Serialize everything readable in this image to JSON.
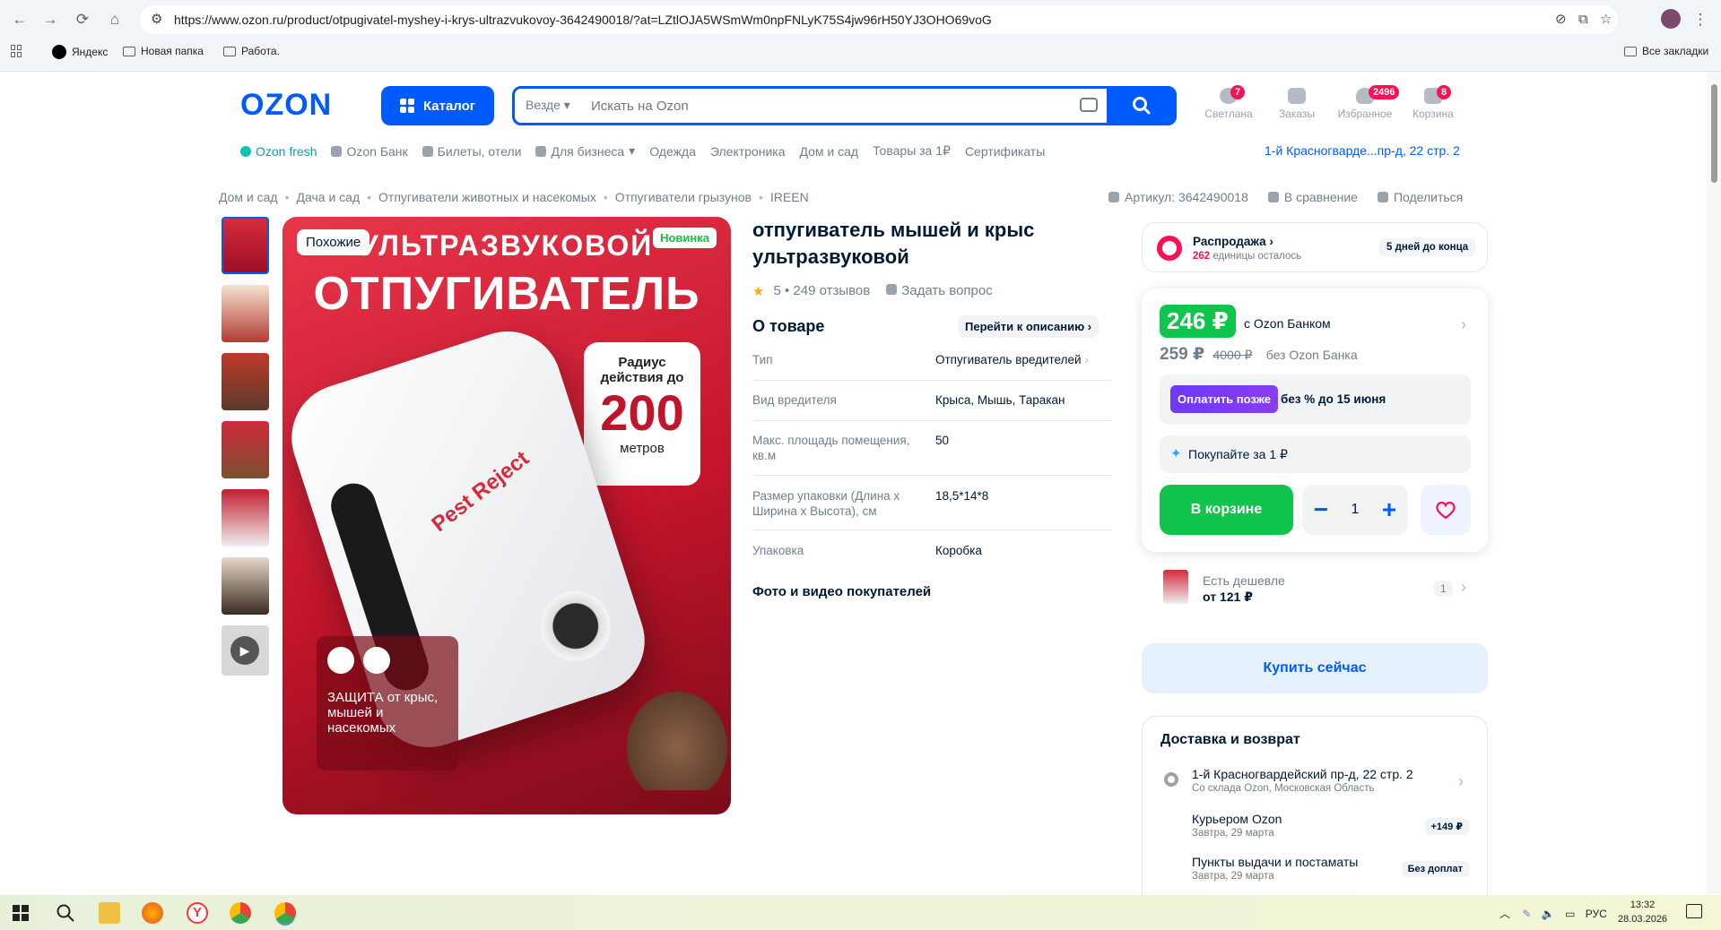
{
  "browser": {
    "url": "https://www.ozon.ru/product/otpugivatel-myshey-i-krys-ultrazvukovoy-3642490018/?at=LZtlOJA5WSmWm0npFNLyK75S4jw96rH50YJ3OHO69voG",
    "bookmarks": [
      "Яндекс",
      "Новая папка",
      "Работа."
    ],
    "all_bookmarks": "Все закладки"
  },
  "header": {
    "logo": "OZON",
    "catalog_label": "Каталог",
    "search_scope": "Везде",
    "search_placeholder": "Искать на Ozon",
    "icons": [
      {
        "label": "Светлана",
        "badge": "7"
      },
      {
        "label": "Заказы",
        "badge": ""
      },
      {
        "label": "Избранное",
        "badge": "2496"
      },
      {
        "label": "Корзина",
        "badge": "8"
      }
    ],
    "subnav": [
      "Ozon fresh",
      "Ozon Банк",
      "Билеты, отели",
      "Для бизнеса",
      "Одежда",
      "Электроника",
      "Дом и сад",
      "Товары за 1₽",
      "Сертификаты"
    ],
    "address": "1-й Красногварде...пр-д, 22 стр. 2"
  },
  "breadcrumbs": [
    "Дом и сад",
    "Дача и сад",
    "Отпугиватели животных и насекомых",
    "Отпугиватели грызунов",
    "IREEN"
  ],
  "top_actions": {
    "article": "Артикул: 3642490018",
    "compare": "В сравнение",
    "share": "Поделиться"
  },
  "gallery": {
    "tag_similar": "Похожие",
    "tag_new": "Новинка",
    "image_text": {
      "headline1": "УЛЬТРАЗВУКОВОЙ",
      "headline2": "ОТПУГИВАТЕЛЬ",
      "radius_label": "Радиус действия до",
      "radius_value": "200",
      "radius_unit": "метров",
      "device_brand": "Pest Reject",
      "protection": "ЗАЩИТА от крыс, мышей и насекомых"
    },
    "thumbnail_count": 7
  },
  "product": {
    "title": "отпугиватель мышей и крыс ультразвуковой",
    "rating": "5",
    "reviews": "249 отзывов",
    "ask": "Задать вопрос",
    "about_title": "О товаре",
    "to_description": "Перейти к описанию",
    "specs": [
      {
        "key": "Тип",
        "value": "Отпугиватель вредителей"
      },
      {
        "key": "Вид вредителя",
        "value": "Крыса, Мышь, Таракан"
      },
      {
        "key": "Макс. площадь помещения, кв.м",
        "value": "50"
      },
      {
        "key": "Размер упаковки (Длина х Ширина х Высота), см",
        "value": "18,5*14*8"
      },
      {
        "key": "Упаковка",
        "value": "Коробка"
      }
    ],
    "photos_title": "Фото и видео покупателей"
  },
  "sale": {
    "title": "Распродажа",
    "remaining_count": "262",
    "remaining_text": "единицы осталось",
    "days_left": "5 дней до конца"
  },
  "pricing": {
    "price_bank": "246 ₽",
    "price_bank_label": "с Ozon Банком",
    "price": "259 ₽",
    "old_price": "4000 ₽",
    "price_label": "без Ozon Банка",
    "pay_later_btn": "Оплатить позже",
    "pay_later_text": "без % до 15 июня",
    "buy_for_1": "Покупайте за 1 ₽",
    "cart_button": "В корзине",
    "quantity": "1",
    "cheaper_title": "Есть дешевле",
    "cheaper_price": "от 121 ₽",
    "cheaper_count": "1",
    "buy_now": "Купить сейчас"
  },
  "delivery": {
    "title": "Доставка и возврат",
    "address": "1-й Красногвардейский пр-д, 22 стр. 2",
    "warehouse": "Со склада Ozon, Московская Область",
    "options": [
      {
        "name": "Курьером Ozon",
        "date": "Завтра, 29 марта",
        "price": "+149 ₽"
      },
      {
        "name": "Пункты выдачи и постаматы",
        "date": "Завтра, 29 марта",
        "price": "Без доплат"
      }
    ]
  },
  "taskbar": {
    "lang": "РУС",
    "time": "13:32",
    "date": "28.03.2026"
  },
  "colors": {
    "brand": "#005bff",
    "green": "#10c44c",
    "pink": "#f91155",
    "purple": "#7a2cf2"
  }
}
